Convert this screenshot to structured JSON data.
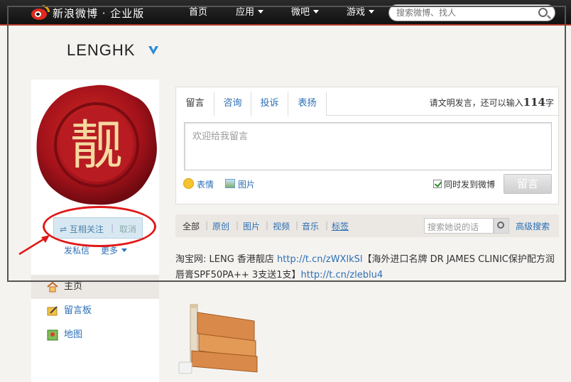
{
  "topbar": {
    "brand": "新浪微博 · 企业版",
    "nav": [
      "首页",
      "应用",
      "微吧",
      "游戏"
    ],
    "search_placeholder": "搜索微博、找人"
  },
  "profile": {
    "username": "LENGHK",
    "avatar_char": "靓",
    "follow_status": "互相关注",
    "cancel": "取消",
    "send_message": "发私信",
    "more": "更多"
  },
  "sidebar": {
    "items": [
      {
        "label": "主页",
        "icon": "home-icon"
      },
      {
        "label": "留言板",
        "icon": "message-board-icon"
      },
      {
        "label": "地图",
        "icon": "map-icon"
      }
    ]
  },
  "message_box": {
    "tabs": [
      "留言",
      "咨询",
      "投诉",
      "表扬"
    ],
    "counter_prefix": "请文明发言，还可以输入",
    "counter_num": "114",
    "counter_suffix": "字",
    "placeholder": "欢迎给我留言",
    "emoji": "表情",
    "image": "图片",
    "also_post": "同时发到微博",
    "submit": "留言"
  },
  "filter": {
    "items": [
      "全部",
      "原创",
      "图片",
      "视频",
      "音乐",
      "标签"
    ],
    "search_placeholder": "搜索她说的话",
    "advanced": "高级搜索"
  },
  "feed": {
    "line1_text": "淘宝网: LENG 香港靓店 ",
    "link1": "http://t.cn/zWXlkSl",
    "line1_text2": "【海外进口名牌 DR JAMES CLINIC保护配方润唇膏SPF50PA++ 3支送1支】",
    "link2": "http://t.cn/zleblu4"
  }
}
